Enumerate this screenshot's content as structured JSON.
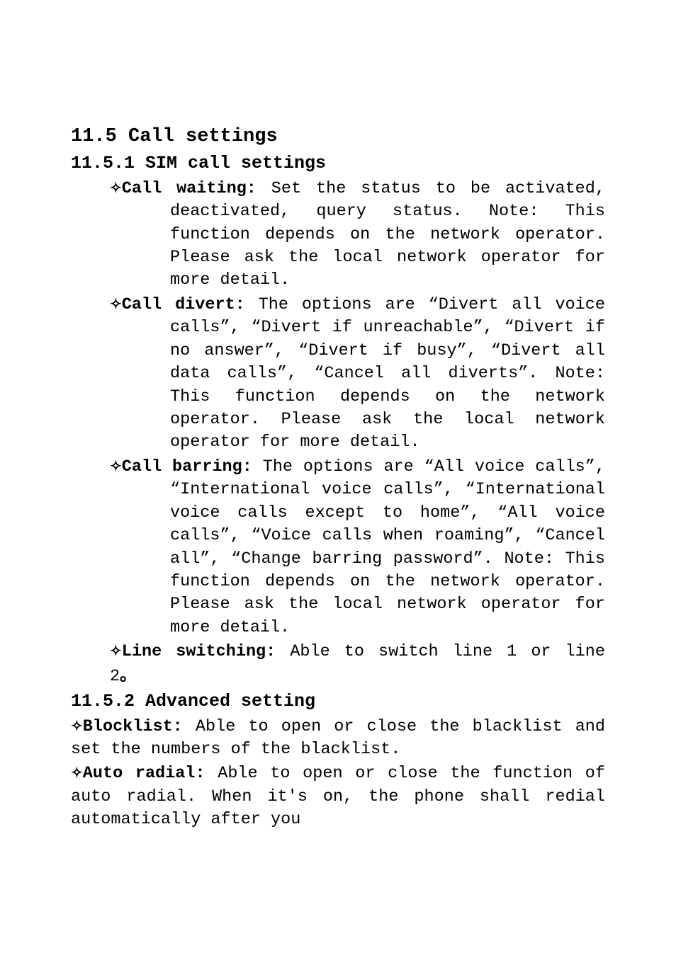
{
  "sections": {
    "call_settings": {
      "title": "11.5 Call settings"
    },
    "sim_call_settings": {
      "title": "11.5.1 SIM call settings",
      "diamond": "✧",
      "items": {
        "call_waiting": {
          "label": "Call waiting:",
          "text": " Set the status to be activated, deactivated, query status. Note: This function depends on the network operator. Please ask the local network operator for more detail."
        },
        "call_divert": {
          "label": "Call divert:",
          "text_pre": " The options are ",
          "opt1": "“Divert all voice calls”",
          "sep": ", ",
          "opt2": "“Divert if unreachable”",
          "opt3": "“Divert if no answer”",
          "opt4": "“Divert if busy”",
          "opt5": "“Divert all data calls”",
          "opt6": "“Cancel all diverts”",
          "text_post": ". Note: This function depends on the network operator. Please ask the local network operator for more detail."
        },
        "call_barring": {
          "label": "Call barring:",
          "text_pre": " The options are ",
          "opt1": "“All voice calls”",
          "sep": ", ",
          "opt2": "“International voice calls”",
          "opt3": "“International voice calls except to home”",
          "opt4": "“All voice calls”",
          "opt5": "“Voice calls when roaming”",
          "opt6": "“Cancel all”",
          "opt7": "“Change barring password”",
          "text_post": ". Note: This function depends on the network operator. Please ask the local network operator for more detail."
        },
        "line_switching": {
          "label": "Line switching:",
          "text": " Able to switch line 1 or line 2",
          "dot": "。"
        }
      }
    },
    "advanced_setting": {
      "title": "11.5.2 Advanced setting",
      "diamond": "✧",
      "items": {
        "blocklist": {
          "label": "Blocklist:",
          "text": " Able to open or close the blacklist and set the numbers of the blacklist."
        },
        "auto_radial": {
          "label": "Auto radial:",
          "text": " Able to open or close the function of auto radial. When it's on, the phone shall redial automatically after you"
        }
      }
    }
  }
}
